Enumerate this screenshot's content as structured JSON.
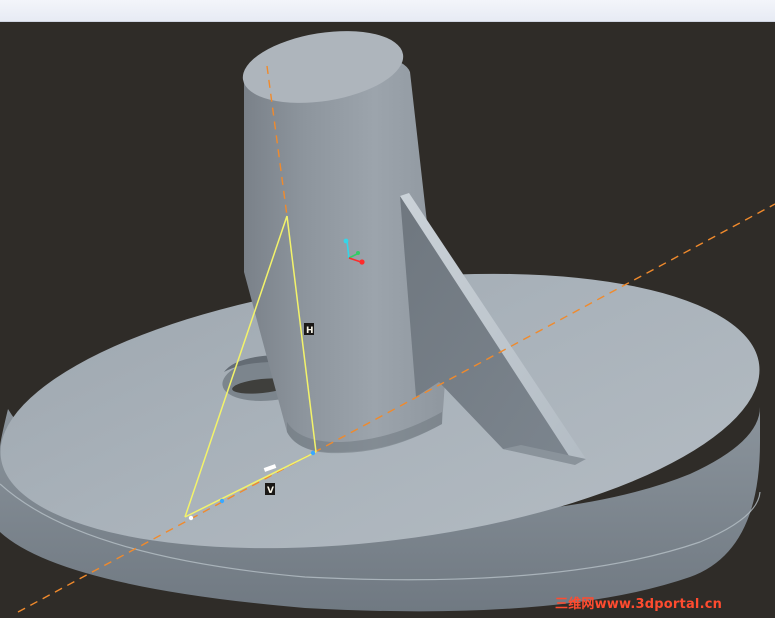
{
  "app": {
    "viewport_background": "#2f2c28",
    "top_strip_color": "#eef1f8"
  },
  "viewport": {
    "part": {
      "name": "ribbed-cylinder-on-disc",
      "base_color": "#a7b0b8",
      "side_color": "#7b858f",
      "cylinder_color": "#9ba3ab",
      "cylinder_top_color": "#aeb5bc"
    },
    "dimensions": {
      "vertical_label": "H",
      "horizontal_label": "V"
    },
    "axes": {
      "x_color": "#ff2b2b",
      "y_color": "#33cc66",
      "z_color": "#35d5e8"
    },
    "datum_line_color": "#f08a2c",
    "sketch_line_color": "#f3f36a"
  },
  "watermark": {
    "text": "三维网www.3dportal.cn",
    "color": "#ff4b2f"
  }
}
